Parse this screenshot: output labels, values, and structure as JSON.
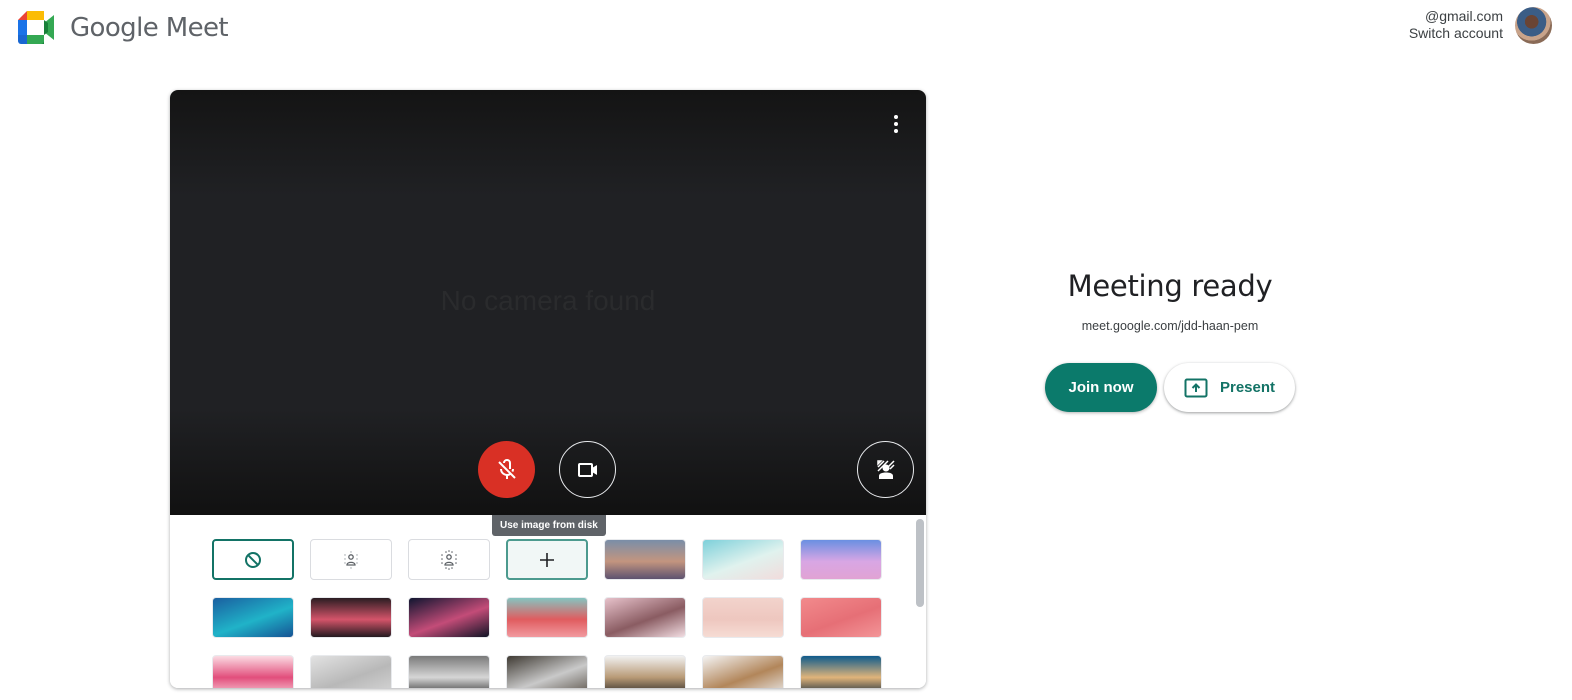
{
  "header": {
    "app_name": "Google Meet",
    "account_email": "@gmail.com",
    "switch_account_label": "Switch account"
  },
  "preview": {
    "no_camera_text": "No camera found",
    "no_camera_subtext": "",
    "more_options_icon": "more-vert-icon",
    "controls": [
      {
        "name": "microphone",
        "state": "off",
        "icon": "mic-off-icon",
        "color": "#d93025"
      },
      {
        "name": "camera",
        "state": "on",
        "icon": "videocam-icon"
      },
      {
        "name": "visual-effects",
        "icon": "visual-effects-icon"
      }
    ],
    "tooltip": "Use image from disk"
  },
  "effects": {
    "tiles": [
      {
        "type": "none",
        "icon": "block-icon",
        "selected": true
      },
      {
        "type": "slight-blur",
        "icon": "blur-slight-icon"
      },
      {
        "type": "blur",
        "icon": "blur-icon"
      },
      {
        "type": "upload",
        "icon": "add-icon"
      },
      {
        "type": "background",
        "label": "sunset-gradient",
        "colors": [
          "#7a8ea8",
          "#c3957f",
          "#5d5270"
        ]
      },
      {
        "type": "background",
        "label": "beach",
        "colors": [
          "#7ed0da",
          "#e0f2ee",
          "#f1dcdc"
        ]
      },
      {
        "type": "background",
        "label": "pink-clouds",
        "colors": [
          "#6a8fe2",
          "#d8a6e4",
          "#e1a3d4"
        ]
      },
      {
        "type": "background",
        "label": "water",
        "colors": [
          "#1a5fa0",
          "#20b3c8",
          "#165394"
        ]
      },
      {
        "type": "background",
        "label": "nebula",
        "colors": [
          "#2a1d22",
          "#d4546a",
          "#241a20"
        ]
      },
      {
        "type": "background",
        "label": "fireworks",
        "colors": [
          "#0f1530",
          "#c34c78",
          "#101426"
        ]
      },
      {
        "type": "background",
        "label": "flowers-sky",
        "colors": [
          "#86c4c0",
          "#e05c5f",
          "#f19aa0"
        ]
      },
      {
        "type": "background",
        "label": "blossoms",
        "colors": [
          "#e7c2cb",
          "#8a5c62",
          "#f2dde2"
        ]
      },
      {
        "type": "background",
        "label": "pink-sparkles",
        "colors": [
          "#f2d3cc",
          "#eec7bf",
          "#f6dcd4"
        ]
      },
      {
        "type": "background",
        "label": "pink-pattern",
        "colors": [
          "#f28a8c",
          "#e66f76",
          "#f39598"
        ]
      },
      {
        "type": "background",
        "label": "confetti",
        "colors": [
          "#fbdbe3",
          "#e24e7c",
          "#f7c7d3"
        ]
      },
      {
        "type": "background",
        "label": "office",
        "colors": [
          "#e2e2e2",
          "#b8b8b8",
          "#d6d6d6"
        ]
      },
      {
        "type": "background",
        "label": "bw-architecture",
        "colors": [
          "#7a7a7a",
          "#d6d6d6",
          "#3a3a3a"
        ]
      },
      {
        "type": "background",
        "label": "room",
        "colors": [
          "#3f3a33",
          "#c9c9c9",
          "#5d554c"
        ]
      },
      {
        "type": "background",
        "label": "bookshelf",
        "colors": [
          "#f1f1f1",
          "#b89a76",
          "#2c2a28"
        ]
      },
      {
        "type": "background",
        "label": "shelves",
        "colors": [
          "#f4f4f4",
          "#b2865a",
          "#e9e9e9"
        ]
      },
      {
        "type": "background",
        "label": "night-cafe",
        "colors": [
          "#0f5b8c",
          "#e0b47a",
          "#172a3b"
        ]
      }
    ]
  },
  "meeting": {
    "title": "Meeting ready",
    "url": "meet.google.com/jdd-haan-pem",
    "join_label": "Join now",
    "present_label": "Present",
    "accent_color": "#0b7a6b"
  }
}
